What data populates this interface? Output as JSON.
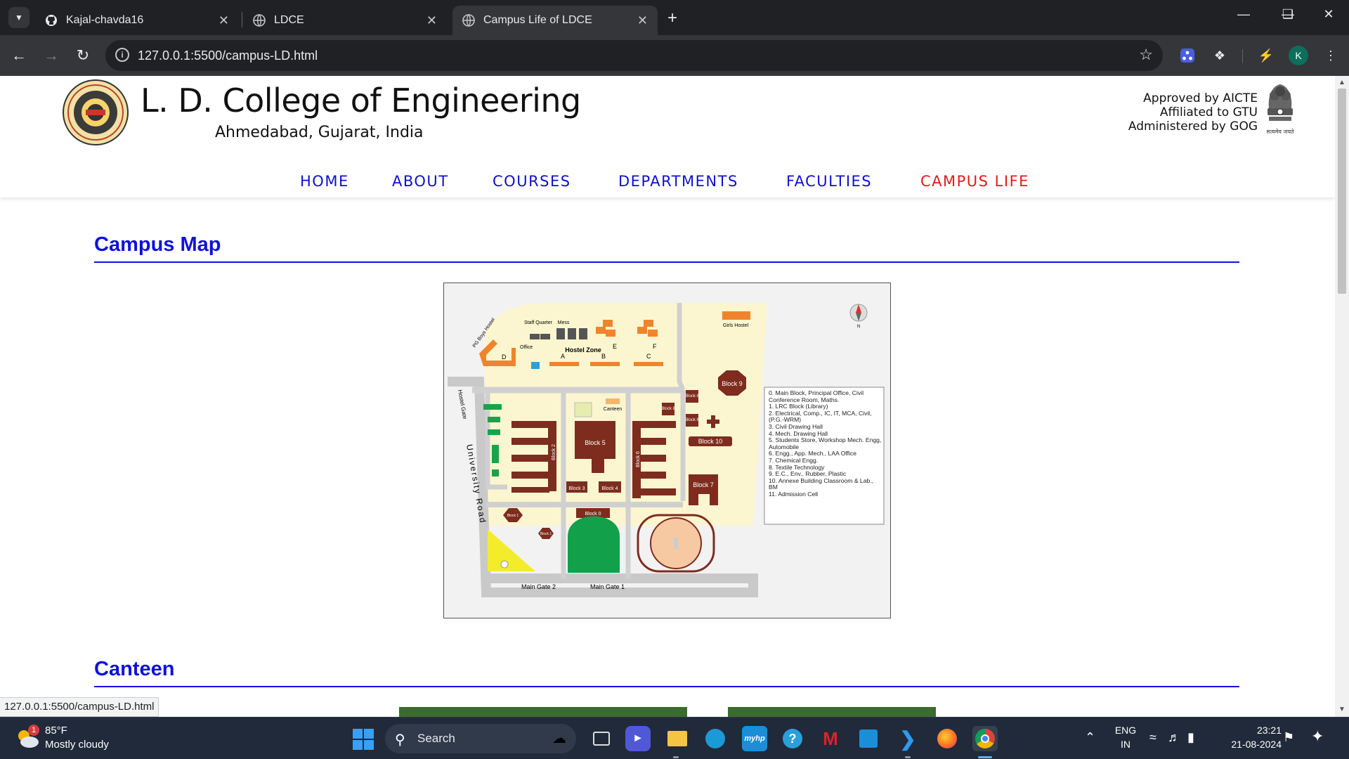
{
  "browser": {
    "tabs": [
      {
        "title": "Kajal-chavda16",
        "icon": "github-icon"
      },
      {
        "title": "LDCE",
        "icon": "globe-icon"
      },
      {
        "title": "Campus Life of LDCE",
        "icon": "globe-icon",
        "active": true
      }
    ],
    "url": "127.0.0.1:5500/campus-LD.html",
    "profile_initial": "K",
    "status_url": "127.0.0.1:5500/campus-LD.html"
  },
  "site": {
    "college_name": "L. D. College of Engineering",
    "location": "Ahmedabad, Gujarat, India",
    "approvals": [
      "Approved by AICTE",
      "Affiliated to GTU",
      "Administered by GOG"
    ],
    "emblem_caption": "सत्यमेव जयते",
    "logo_text": "L.D. COLLEGE OF ENGINEERING",
    "logo_sub": "AHMEDABAD",
    "nav": [
      {
        "label": "HOME"
      },
      {
        "label": "ABOUT"
      },
      {
        "label": "COURSES"
      },
      {
        "label": "DEPARTMENTS"
      },
      {
        "label": "FACULTIES"
      },
      {
        "label": "CAMPUS LIFE",
        "active": true
      }
    ],
    "accent_color": "#1010dd",
    "active_nav_color": "#e01b1b"
  },
  "sections": [
    {
      "title": "Campus Map"
    },
    {
      "title": "Canteen"
    }
  ],
  "campus_map": {
    "zone_label": "Hostel Zone",
    "labels": {
      "staff_quarter": "Staff Quarter",
      "mess": "Mess",
      "girls_hostel": "Girls Hostel",
      "pg_boys_hostel": "PG Boys Hostel",
      "office": "Office",
      "hostel_gate": "Hostel Gate",
      "university_road": "University Road",
      "canteen": "Canteen",
      "main_gate_2": "Main Gate 2",
      "main_gate_1": "Main Gate 1",
      "north": "N",
      "hostel_letters": [
        "D",
        "A",
        "B",
        "C",
        "E",
        "F"
      ],
      "blocks": [
        "Block 5",
        "Block 9",
        "Block 10",
        "Block 7",
        "Block 2",
        "Block 6",
        "Block 3",
        "Block 4",
        "Block 0",
        "Block 8",
        "Block 8",
        "Block 8",
        "Block 1",
        "Block 1"
      ]
    },
    "legend": [
      "0.  Main Block, Principal Office, Civil Conference Room, Maths.",
      "1.  LRC Block (Library)",
      "2.  Electrical, Comp., IC, IT, MCA, Civil, (P.G.-WRM)",
      "3.  Civil Drawing Hall",
      "4.  Mech. Drawing Hall",
      "5.  Students Store, Workshop Mech. Engg, Automobile",
      "6.  Engg., App. Mech., LAA Office",
      "7.  Chemical Engg.",
      "8.  Textile Technology",
      "9.  E.C., Env., Rubber, Plastic",
      "10. Annexe Building Classroom & Lab., BM",
      "11. Admission Cell"
    ]
  },
  "taskbar": {
    "weather_temp": "85°F",
    "weather_desc": "Mostly cloudy",
    "weather_badge": "1",
    "search_label": "Search",
    "lang_top": "ENG",
    "lang_bottom": "IN",
    "time": "23:21",
    "date": "21-08-2024",
    "apps": [
      "task-view-icon",
      "teams-icon",
      "file-explorer-icon",
      "edge-icon",
      "myhp-icon",
      "help-icon",
      "mcafee-icon",
      "store-icon",
      "vscode-icon",
      "firefox-icon",
      "chrome-icon"
    ]
  }
}
